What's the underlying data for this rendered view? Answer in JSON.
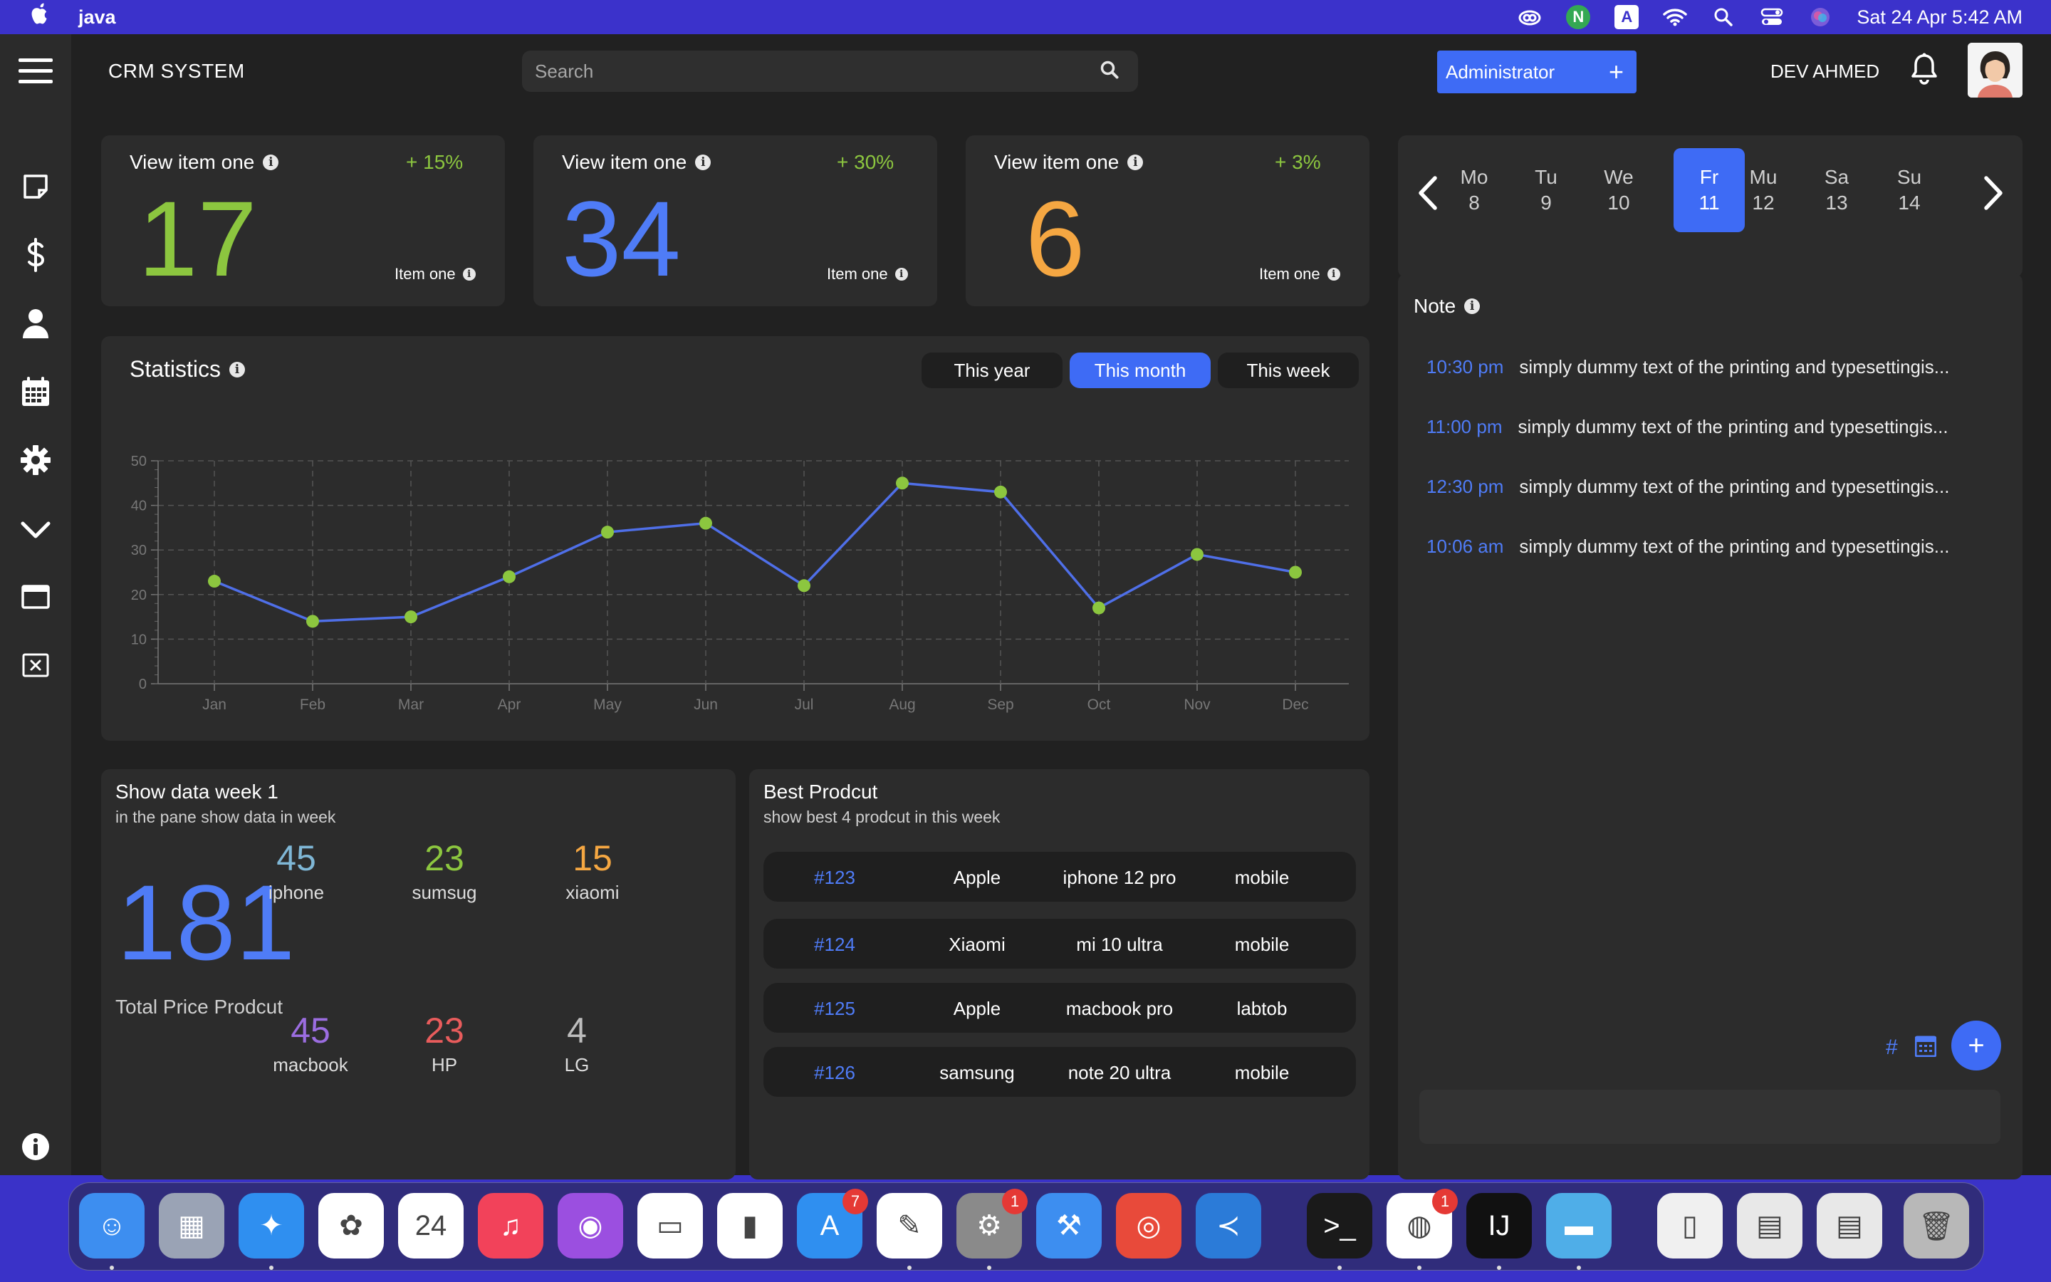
{
  "menubar": {
    "app_name": "java",
    "datetime": "Sat 24 Apr  5:42 AM",
    "icons": [
      "creative-cloud-icon",
      "n-app-icon",
      "input-source-icon",
      "wifi-icon",
      "spotlight-icon",
      "control-center-icon",
      "siri-icon"
    ],
    "n_glyph": "N",
    "a_glyph": "A"
  },
  "header": {
    "title": "CRM SYSTEM",
    "search_placeholder": "Search",
    "admin_label": "Administrator",
    "admin_plus": "+",
    "user_name": "DEV AHMED"
  },
  "sidebar": {
    "items": [
      "menu-icon",
      "note-icon",
      "dollar-icon",
      "user-icon",
      "calendar-icon",
      "settings-icon",
      "chevron-down-icon",
      "window-icon",
      "close-box-icon",
      "info-icon"
    ]
  },
  "kpis": [
    {
      "title": "View item one",
      "change": "+ 15%",
      "value": "17",
      "sub": "Item one",
      "color": "#8cc63f"
    },
    {
      "title": "View item one",
      "change": "+ 30%",
      "value": "34",
      "sub": "Item one",
      "color": "#4f7cf7"
    },
    {
      "title": "View item one",
      "change": "+ 3%",
      "value": "6",
      "sub": "Item one",
      "color": "#f5a742"
    }
  ],
  "statistics": {
    "title": "Statistics",
    "filters": [
      "This year",
      "This month",
      "This week"
    ],
    "active_filter": "This month"
  },
  "chart_data": {
    "type": "line",
    "categories": [
      "Jan",
      "Feb",
      "Mar",
      "Apr",
      "May",
      "Jun",
      "Jul",
      "Aug",
      "Sep",
      "Oct",
      "Nov",
      "Dec"
    ],
    "values": [
      23,
      14,
      15,
      24,
      34,
      36,
      22,
      45,
      43,
      17,
      29,
      25
    ],
    "ylim": [
      0,
      50
    ],
    "yticks": [
      0,
      10,
      20,
      30,
      40,
      50
    ],
    "line_color": "#4f6fe8",
    "point_color": "#8cc63f",
    "grid": true
  },
  "calendar": {
    "days": [
      {
        "name": "Mo",
        "num": "8"
      },
      {
        "name": "Tu",
        "num": "9"
      },
      {
        "name": "We",
        "num": "10"
      },
      {
        "name": "Fr",
        "num": "11"
      },
      {
        "name": "Mu",
        "num": "12"
      },
      {
        "name": "Sa",
        "num": "13"
      },
      {
        "name": "Su",
        "num": "14"
      }
    ],
    "active_index": 3,
    "prev": "‹",
    "next": "›"
  },
  "notes": {
    "title": "Note",
    "items": [
      {
        "time": "10:30 pm",
        "text": "simply dummy text of the printing and typesettingis..."
      },
      {
        "time": "11:00 pm",
        "text": "simply dummy text of the printing and typesettingis..."
      },
      {
        "time": "12:30 pm",
        "text": "simply dummy text of the printing and typesettingis..."
      },
      {
        "time": "10:06 am",
        "text": "simply dummy text of the printing and typesettingis..."
      }
    ],
    "hash": "#",
    "add": "+"
  },
  "week_data": {
    "title": "Show data week 1",
    "subtitle": "in the pane show data in week",
    "total": "181",
    "total_label": "Total Price Prodcut",
    "brands": [
      {
        "value": "45",
        "label": "iphone",
        "color": "#7fb7d6"
      },
      {
        "value": "23",
        "label": "sumsug",
        "color": "#8cc63f"
      },
      {
        "value": "15",
        "label": "xiaomi",
        "color": "#f5a742"
      },
      {
        "value": "45",
        "label": "macbook",
        "color": "#9b6de0"
      },
      {
        "value": "23",
        "label": "HP",
        "color": "#e85c5c"
      },
      {
        "value": "4",
        "label": "LG",
        "color": "#bdbdbd"
      }
    ]
  },
  "best_product": {
    "title": "Best Prodcut",
    "subtitle": "show best 4 prodcut in this week",
    "rows": [
      {
        "id": "#123",
        "brand": "Apple",
        "model": "iphone 12 pro",
        "type": "mobile"
      },
      {
        "id": "#124",
        "brand": "Xiaomi",
        "model": "mi 10 ultra",
        "type": "mobile"
      },
      {
        "id": "#125",
        "brand": "Apple",
        "model": "macbook pro",
        "type": "labtob"
      },
      {
        "id": "#126",
        "brand": "samsung",
        "model": "note 20 ultra",
        "type": "mobile"
      }
    ]
  },
  "dock": {
    "apps": [
      {
        "name": "finder-icon",
        "glyph": "☺",
        "bg": "#3d8ef0"
      },
      {
        "name": "launchpad-icon",
        "glyph": "▦",
        "bg": "#9aa3b5"
      },
      {
        "name": "safari-icon",
        "glyph": "✦",
        "bg": "#2f8ff0"
      },
      {
        "name": "photos-icon",
        "glyph": "✿",
        "bg": "#ffffff"
      },
      {
        "name": "calendar-app-icon",
        "glyph": "24",
        "bg": "#ffffff"
      },
      {
        "name": "music-icon",
        "glyph": "♫",
        "bg": "#f2425a"
      },
      {
        "name": "podcasts-icon",
        "glyph": "◉",
        "bg": "#9b4fe0"
      },
      {
        "name": "keynote-icon",
        "glyph": "▭",
        "bg": "#ffffff"
      },
      {
        "name": "numbers-icon",
        "glyph": "▮",
        "bg": "#ffffff"
      },
      {
        "name": "app-store-icon",
        "glyph": "A",
        "bg": "#2f8ff0"
      },
      {
        "name": "pages-icon",
        "glyph": "✎",
        "bg": "#ffffff"
      },
      {
        "name": "system-preferences-icon",
        "glyph": "⚙",
        "bg": "#8a8a8a"
      },
      {
        "name": "xcode-icon",
        "glyph": "⚒",
        "bg": "#3d8ef0"
      },
      {
        "name": "instruments-icon",
        "glyph": "◎",
        "bg": "#e84a3a"
      },
      {
        "name": "vscode-icon",
        "glyph": "≺",
        "bg": "#2b7bd8"
      },
      {
        "name": "terminal-icon",
        "glyph": ">_",
        "bg": "#1a1a1a"
      },
      {
        "name": "chrome-icon",
        "glyph": "◍",
        "bg": "#ffffff"
      },
      {
        "name": "intellij-icon",
        "glyph": "IJ",
        "bg": "#111111"
      },
      {
        "name": "folder-icon",
        "glyph": "▬",
        "bg": "#4faee8"
      },
      {
        "name": "document-icon",
        "glyph": "▯",
        "bg": "#f0f0f0"
      },
      {
        "name": "window-preview-1-icon",
        "glyph": "▤",
        "bg": "#e8e8e8"
      },
      {
        "name": "window-preview-2-icon",
        "glyph": "▤",
        "bg": "#e8e8e8"
      },
      {
        "name": "trash-icon",
        "glyph": "🗑",
        "bg": "#b8b8b8"
      }
    ],
    "badges": {
      "app-store-icon": "7",
      "system-preferences-icon": "1",
      "chrome-icon": "1"
    }
  }
}
